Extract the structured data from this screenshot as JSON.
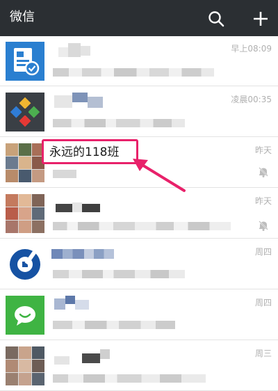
{
  "header": {
    "title": "微信"
  },
  "chats": [
    {
      "time": "早上08:09",
      "muted": false
    },
    {
      "time": "凌晨00:35",
      "muted": false
    },
    {
      "time": "昨天",
      "muted": true
    },
    {
      "time": "昨天",
      "muted": true
    },
    {
      "time": "周四",
      "muted": false
    },
    {
      "time": "周四",
      "muted": false
    },
    {
      "time": "周三",
      "muted": false
    }
  ],
  "callout": {
    "label": "永远的118班"
  },
  "colors": {
    "topbar": "#2b2f33",
    "accent": "#e8216a",
    "time": "#b0b0b0",
    "wechat_green": "#3fb443",
    "bank_blue": "#1652a3"
  }
}
